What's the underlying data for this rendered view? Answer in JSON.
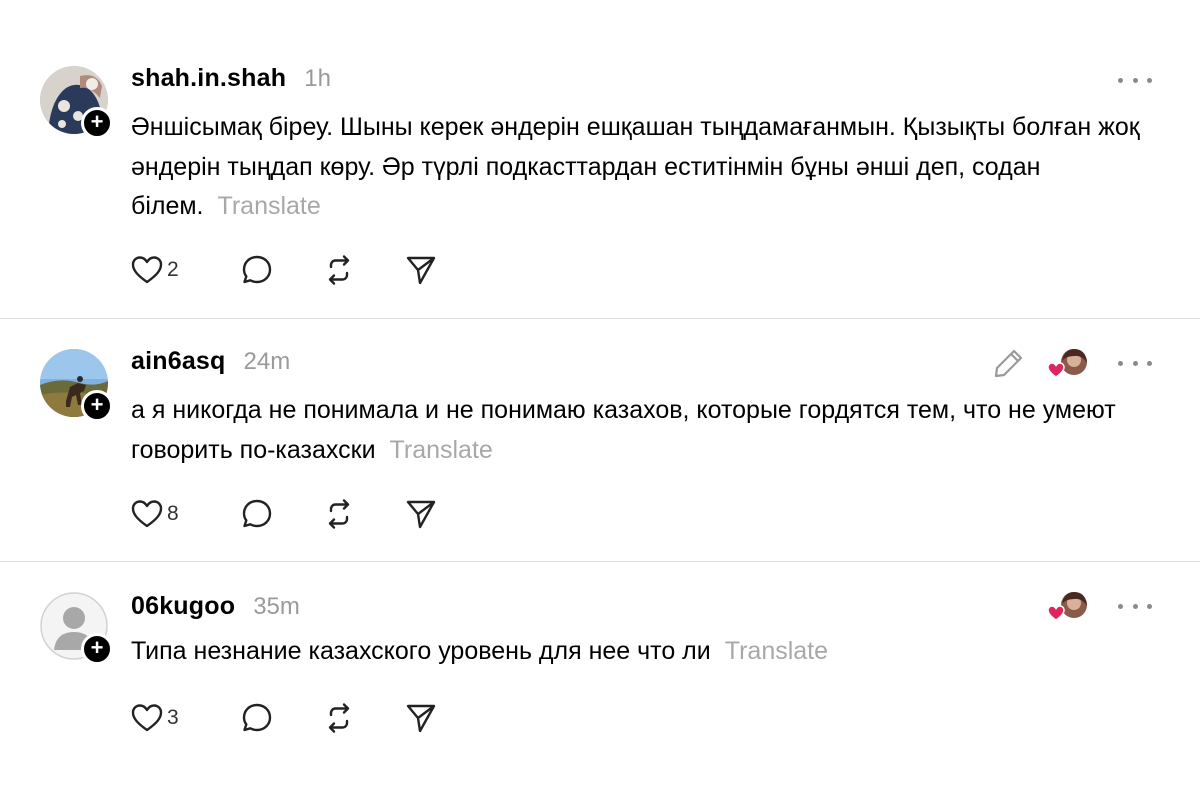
{
  "posts": [
    {
      "username": "shah.in.shah",
      "time": "1h",
      "text": "Әншісымақ біреу. Шыны керек әндерін ешқашан тыңдамағанмын. Қызықты болған жоқ әндерін тыңдап көру. Әр түрлі подкасттардан еститінмін бұны әнші деп, содан білем.",
      "translate": "Translate",
      "likes": "2",
      "avatar_icon": "profile-photo"
    },
    {
      "username": "ain6asq",
      "time": "24m",
      "text": "а я никогда не понимала и не понимаю казахов, которые гордятся тем, что не умеют говорить по-казахски",
      "translate": "Translate",
      "likes": "8",
      "avatar_icon": "profile-photo"
    },
    {
      "username": "06kugoo",
      "time": "35m",
      "text": "Типа незнание казахского уровень для нее что ли",
      "translate": "Translate",
      "likes": "3",
      "avatar_icon": "default-user-icon"
    }
  ],
  "colors": {
    "text": "#000000",
    "muted": "#9a9a9a",
    "divider": "#dcdcdc",
    "heart_reaction": "#e0245e"
  }
}
